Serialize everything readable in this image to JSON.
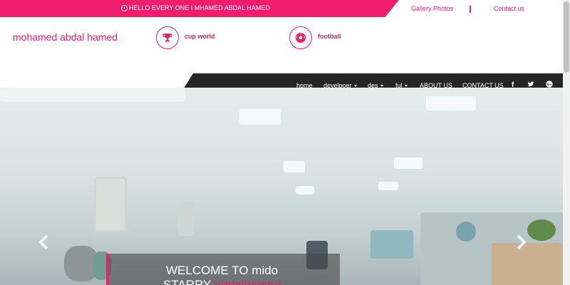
{
  "topbar": {
    "greeting": "HELLO EVERY ONE I MHAMED ABDAL HAMED",
    "links": [
      "Gallery Photos",
      "Contact us"
    ]
  },
  "brand": {
    "name": "mohamed abdal hamed"
  },
  "features": [
    {
      "icon": "trophy-icon",
      "label": "cup world"
    },
    {
      "icon": "soccer-ball-icon",
      "label": "football"
    }
  ],
  "nav": {
    "items": [
      {
        "label": "home",
        "dropdown": false
      },
      {
        "label": "develpoer",
        "dropdown": true
      },
      {
        "label": "des",
        "dropdown": true
      },
      {
        "label": "ful",
        "dropdown": true
      },
      {
        "label": "ABOUT US",
        "dropdown": false
      },
      {
        "label": "CONTACT US",
        "dropdown": false
      }
    ],
    "social": [
      "facebook-icon",
      "twitter-icon",
      "google-plus-icon"
    ]
  },
  "hero": {
    "line1": "WELCOME TO mido",
    "line2_white": "STARRY ",
    "line2_pink": "abdalhamed"
  },
  "colors": {
    "accent": "#ef1d6b",
    "nav_bg": "#262626"
  }
}
